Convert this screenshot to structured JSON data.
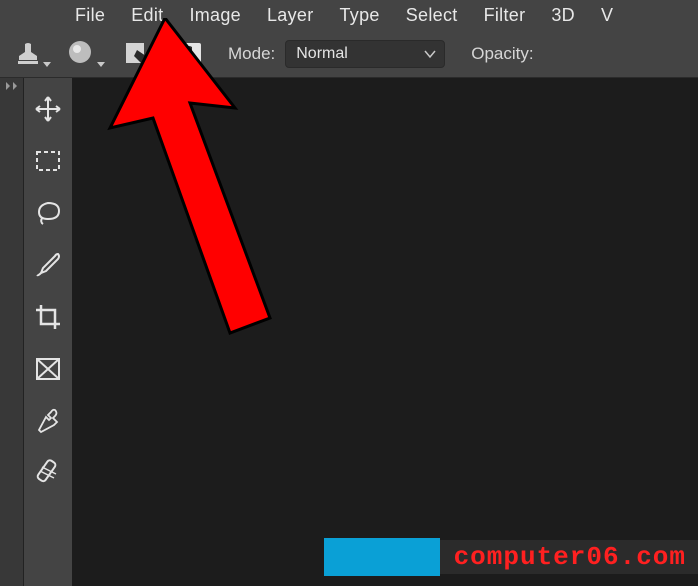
{
  "menubar": {
    "items": [
      "File",
      "Edit",
      "Image",
      "Layer",
      "Type",
      "Select",
      "Filter",
      "3D",
      "V"
    ]
  },
  "optionsBar": {
    "modeLabel": "Mode:",
    "modeValue": "Normal",
    "opacityLabel": "Opacity:"
  },
  "toolbox": {
    "tools": [
      "move",
      "marquee",
      "lasso",
      "brush",
      "crop",
      "frame",
      "eyedropper",
      "healing"
    ]
  },
  "watermark": {
    "text": "computer06.com"
  }
}
